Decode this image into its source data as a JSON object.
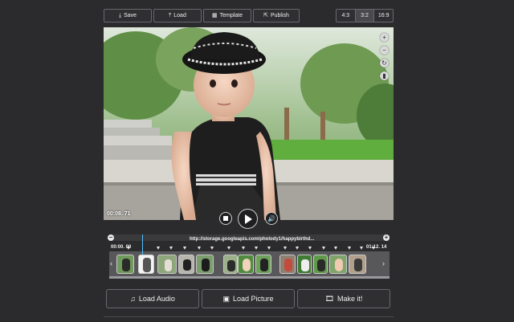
{
  "toolbar": {
    "save": "Save",
    "load": "Load",
    "template": "Template",
    "publish": "Publish"
  },
  "ratios": [
    "4:3",
    "3:2",
    "16:9"
  ],
  "active_ratio": "3:2",
  "player": {
    "time": "00:08. 71"
  },
  "timeline": {
    "start_time": "00:00. 00",
    "end_time": "01:12. 14",
    "audio_url": "http://storage.googleapis.com/pholody1/happybirthd..."
  },
  "actions": {
    "load_audio": "Load Audio",
    "load_picture": "Load Picture",
    "make_it": "Make it!"
  },
  "colors": {
    "background": "#2b2a2c",
    "playhead": "#4cc3ff"
  }
}
